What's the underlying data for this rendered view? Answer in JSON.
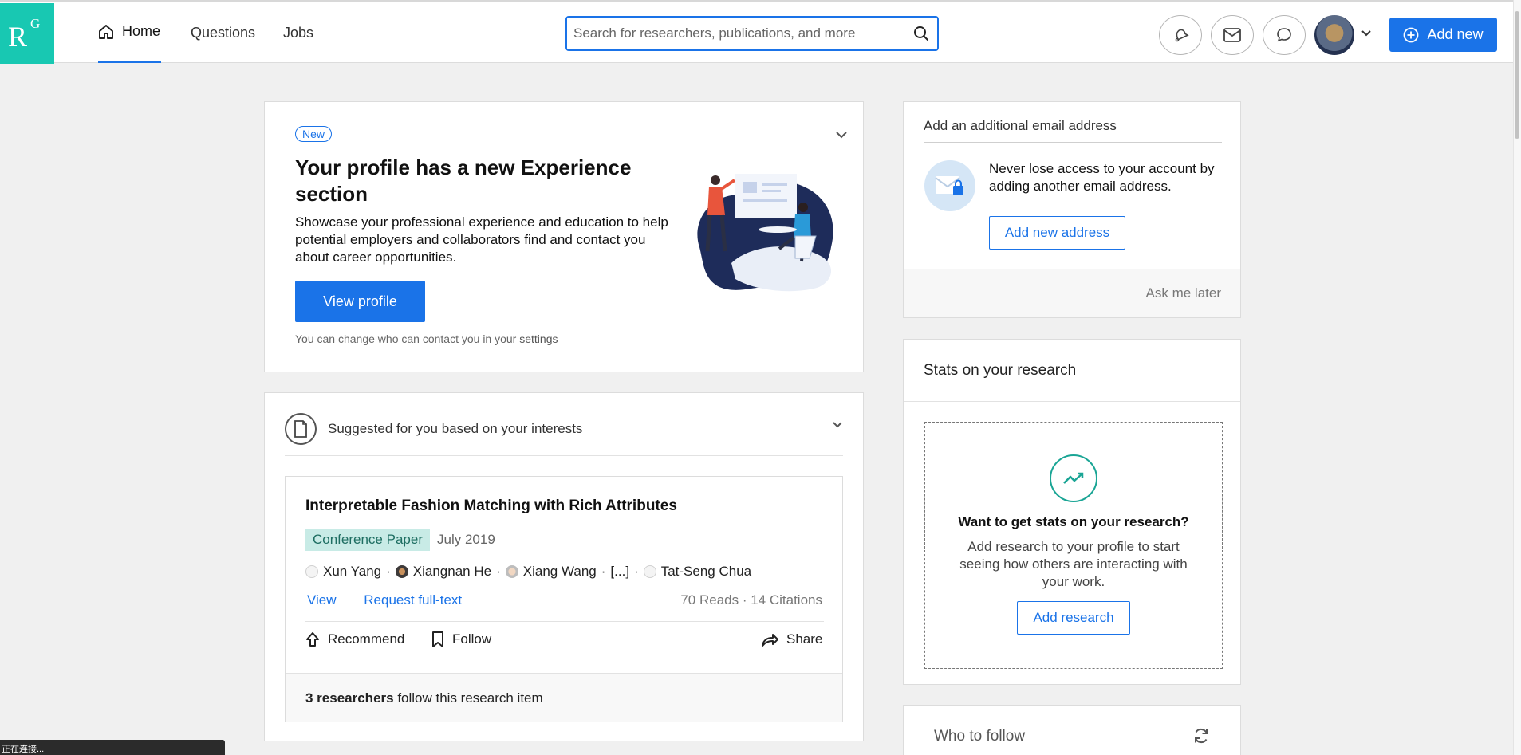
{
  "nav": {
    "logo_main": "R",
    "logo_sup": "G",
    "home": "Home",
    "questions": "Questions",
    "jobs": "Jobs",
    "search_placeholder": "Search for researchers, publications, and more",
    "add_new": "Add new"
  },
  "experience": {
    "badge": "New",
    "title": "Your profile has a new Experience section",
    "description": "Showcase your professional experience and education to help potential employers and collaborators find and contact you about career opportunities.",
    "button": "View profile",
    "note_prefix": "You can change who can contact you in your ",
    "note_link": "settings"
  },
  "suggested": {
    "header": "Suggested for you based on your interests",
    "item": {
      "title": "Interpretable Fashion Matching with Rich Attributes",
      "type": "Conference Paper",
      "date": "July 2019",
      "authors": [
        "Xun Yang",
        "Xiangnan He",
        "Xiang Wang",
        "[...]",
        "Tat-Seng Chua"
      ],
      "view": "View",
      "request": "Request full-text",
      "stats": "70 Reads · 14 Citations",
      "recommend": "Recommend",
      "follow": "Follow",
      "share": "Share",
      "footer_bold": "3 researchers",
      "footer_rest": " follow this research item"
    }
  },
  "email": {
    "header": "Add an additional email address",
    "text": "Never lose access to your account by adding another email address.",
    "button": "Add new address",
    "later": "Ask me later"
  },
  "stats": {
    "header": "Stats on your research",
    "question": "Want to get stats on your research?",
    "description": "Add research to your profile to start seeing how others are interacting with your work.",
    "button": "Add research"
  },
  "follow": {
    "header": "Who to follow"
  },
  "status_text": "正在连接..."
}
